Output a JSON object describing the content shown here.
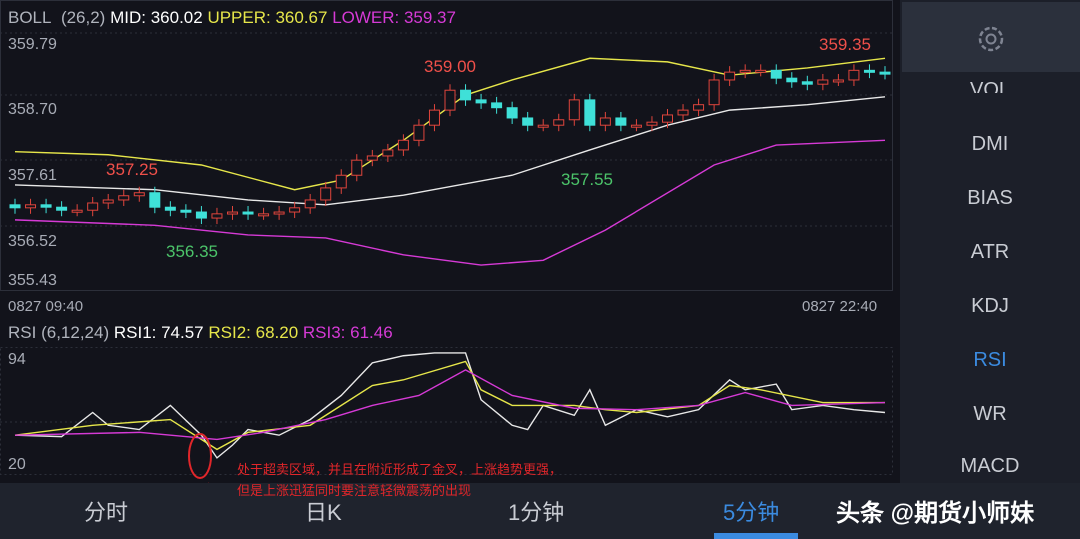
{
  "boll_header": {
    "name": "BOLL",
    "params": "(26,2)",
    "mid": "MID: 360.02",
    "upper": "UPPER: 360.67",
    "lower": "LOWER: 359.37"
  },
  "price_axis": [
    "359.79",
    "358.70",
    "357.61",
    "356.52",
    "355.43"
  ],
  "time_axis": {
    "start": "0827 09:40",
    "end": "0827 22:40"
  },
  "price_annotations": {
    "high1": "357.25",
    "low1": "356.35",
    "high2": "359.00",
    "low2": "357.55",
    "high3": "359.35"
  },
  "rsi_header": {
    "name": "RSI",
    "params": "(6,12,24)",
    "rsi1": "RSI1: 74.57",
    "rsi2": "RSI2: 68.20",
    "rsi3": "RSI3: 61.46"
  },
  "rsi_axis": [
    "94",
    "20"
  ],
  "sidebar": {
    "items": [
      "VOL",
      "DMI",
      "BIAS",
      "ATR",
      "KDJ",
      "RSI",
      "WR",
      "MACD"
    ],
    "active": "RSI"
  },
  "tabs": [
    "分时",
    "日K",
    "1分钟",
    "5分钟"
  ],
  "active_tab": "5分钟",
  "note": [
    "处于超卖区域，并且在附近形成了金叉，上涨趋势更强，",
    "但是上涨迅猛同时要注意轻微震荡的出现"
  ],
  "watermark": "头条 @期货小师妹",
  "colors": {
    "up": "#e0453c",
    "down": "#3fe0d8",
    "mid": "#e8e8e8",
    "upper": "#e6e64a",
    "lower": "#d63ad6",
    "accent": "#3b8be0"
  },
  "chart_data": [
    {
      "type": "candlestick",
      "price_range": [
        355.43,
        359.79
      ],
      "closes": [
        357.09,
        357.14,
        357.1,
        357.05,
        357.05,
        357.17,
        357.22,
        357.29,
        357.34,
        357.1,
        357.05,
        357.02,
        356.92,
        356.99,
        357.02,
        356.99,
        356.99,
        357.02,
        357.09,
        357.22,
        357.42,
        357.63,
        357.88,
        357.95,
        358.05,
        358.21,
        358.46,
        358.71,
        359.04,
        358.88,
        358.83,
        358.75,
        358.58,
        358.46,
        358.46,
        358.55,
        358.88,
        358.46,
        358.58,
        358.46,
        358.46,
        358.51,
        358.63,
        358.71,
        358.8,
        359.21,
        359.34,
        359.37,
        359.37,
        359.24,
        359.18,
        359.14,
        359.21,
        359.21,
        359.37,
        359.34,
        359.32
      ],
      "upper": [
        [
          0,
          358.02
        ],
        [
          6,
          357.97
        ],
        [
          12,
          357.8
        ],
        [
          18,
          357.39
        ],
        [
          21,
          357.55
        ],
        [
          25,
          358.21
        ],
        [
          29,
          358.96
        ],
        [
          32,
          359.21
        ],
        [
          37,
          359.57
        ],
        [
          42,
          359.51
        ],
        [
          46,
          359.29
        ],
        [
          51,
          359.41
        ],
        [
          56,
          359.57
        ]
      ],
      "mid": [
        [
          0,
          357.47
        ],
        [
          9,
          357.39
        ],
        [
          15,
          357.22
        ],
        [
          20,
          357.14
        ],
        [
          25,
          357.3
        ],
        [
          32,
          357.63
        ],
        [
          37,
          358.05
        ],
        [
          42,
          358.46
        ],
        [
          46,
          358.71
        ],
        [
          51,
          358.8
        ],
        [
          56,
          358.93
        ]
      ],
      "lower": [
        [
          0,
          356.89
        ],
        [
          9,
          356.8
        ],
        [
          15,
          356.64
        ],
        [
          20,
          356.59
        ],
        [
          25,
          356.31
        ],
        [
          30,
          356.14
        ],
        [
          34,
          356.22
        ],
        [
          38,
          356.72
        ],
        [
          45,
          357.8
        ],
        [
          49,
          358.13
        ],
        [
          56,
          358.21
        ]
      ]
    },
    {
      "type": "line",
      "name": "RSI",
      "range": [
        20,
        94
      ],
      "series": [
        {
          "name": "RSI1",
          "points": [
            [
              0,
              41
            ],
            [
              3,
              40
            ],
            [
              5,
              57
            ],
            [
              6,
              48
            ],
            [
              8,
              45
            ],
            [
              10,
              62
            ],
            [
              12,
              41
            ],
            [
              13,
              25
            ],
            [
              14,
              34
            ],
            [
              15,
              45
            ],
            [
              17,
              41
            ],
            [
              19,
              52
            ],
            [
              21,
              69
            ],
            [
              23,
              92
            ],
            [
              25,
              97
            ],
            [
              27,
              99
            ],
            [
              29,
              99
            ],
            [
              30,
              66
            ],
            [
              32,
              48
            ],
            [
              33,
              45
            ],
            [
              34,
              62
            ],
            [
              36,
              55
            ],
            [
              37,
              73
            ],
            [
              38,
              48
            ],
            [
              40,
              59
            ],
            [
              42,
              54
            ],
            [
              44,
              59
            ],
            [
              46,
              80
            ],
            [
              47,
              73
            ],
            [
              49,
              77
            ],
            [
              50,
              59
            ],
            [
              52,
              62
            ],
            [
              54,
              59
            ],
            [
              56,
              57
            ]
          ]
        },
        {
          "name": "RSI2",
          "points": [
            [
              0,
              41
            ],
            [
              5,
              48
            ],
            [
              10,
              52
            ],
            [
              13,
              31
            ],
            [
              15,
              43
            ],
            [
              19,
              48
            ],
            [
              23,
              76
            ],
            [
              25,
              80
            ],
            [
              29,
              93
            ],
            [
              30,
              73
            ],
            [
              32,
              62
            ],
            [
              36,
              62
            ],
            [
              38,
              59
            ],
            [
              40,
              57
            ],
            [
              44,
              62
            ],
            [
              46,
              76
            ],
            [
              48,
              73
            ],
            [
              52,
              64
            ],
            [
              56,
              64
            ]
          ]
        },
        {
          "name": "RSI3",
          "points": [
            [
              0,
              41
            ],
            [
              8,
              43
            ],
            [
              13,
              38
            ],
            [
              16,
              43
            ],
            [
              20,
              52
            ],
            [
              23,
              62
            ],
            [
              26,
              69
            ],
            [
              29,
              87
            ],
            [
              32,
              69
            ],
            [
              36,
              60
            ],
            [
              40,
              59
            ],
            [
              44,
              62
            ],
            [
              47,
              71
            ],
            [
              50,
              62
            ],
            [
              56,
              64
            ]
          ]
        }
      ]
    }
  ]
}
